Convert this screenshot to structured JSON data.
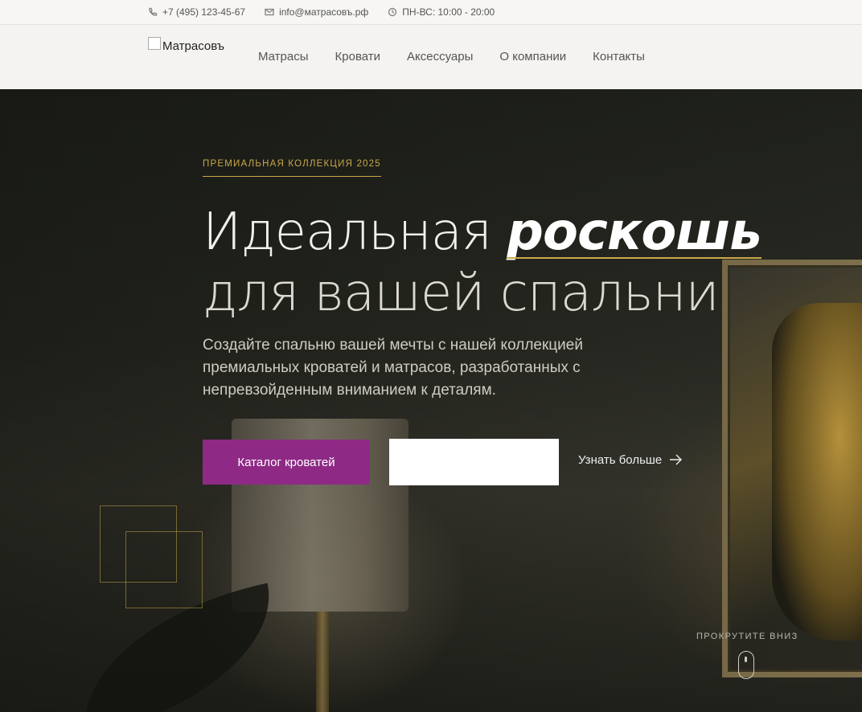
{
  "topbar": {
    "phone": "+7 (495) 123-45-67",
    "email": "info@матрасовъ.рф",
    "hours": "ПН-ВС: 10:00 - 20:00"
  },
  "header": {
    "logo_alt": "Матрасовъ",
    "menu": [
      {
        "label": "Матрасы"
      },
      {
        "label": "Кровати"
      },
      {
        "label": "Аксессуары"
      },
      {
        "label": "О компании"
      },
      {
        "label": "Контакты"
      }
    ]
  },
  "hero": {
    "eyebrow": "ПРЕМИАЛЬНАЯ КОЛЛЕКЦИЯ 2025",
    "title_plain": "Идеальная ",
    "title_accent": "роскошь",
    "title_line2": "для вашей спальни",
    "lead": "Создайте спальню вашей мечты с нашей коллекцией премиальных кроватей и матрасов, разработанных с непревзойденным вниманием к деталям.",
    "primary_button": "Каталог кроватей",
    "learn_more": "Узнать больше",
    "scroll_hint": "ПРОКРУТИТЕ ВНИЗ"
  },
  "colors": {
    "accent_gold": "#c9a94a",
    "brand_purple": "#8e2a86"
  },
  "icons": [
    "phone-icon",
    "mail-icon",
    "clock-icon",
    "arrow-right-icon",
    "mouse-icon"
  ]
}
